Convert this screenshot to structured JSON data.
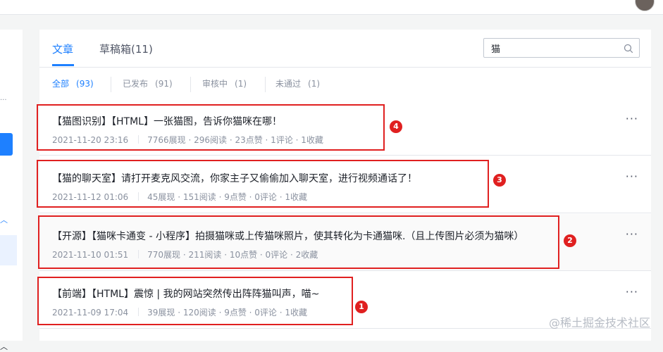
{
  "tabs": [
    {
      "label": "文章",
      "active": true
    },
    {
      "label": "草稿箱(11)",
      "active": false
    }
  ],
  "search": {
    "value": "猫",
    "icon": "search-icon"
  },
  "filters": [
    {
      "label": "全部",
      "count": "(93)",
      "active": true
    },
    {
      "label": "已发布",
      "count": "(91)",
      "active": false
    },
    {
      "label": "审核中",
      "count": "(1)",
      "active": false
    },
    {
      "label": "未通过",
      "count": "(1)",
      "active": false
    }
  ],
  "articles": [
    {
      "title": "【猫图识别】【HTML】一张猫图，告诉你猫咪在哪！",
      "date": "2021-11-20 23:16",
      "stats": "7766展现 · 296阅读 · 23点赞 · 1评论 · 1收藏",
      "badge": "4"
    },
    {
      "title": "【猫的聊天室】请打开麦克风交流，你家主子又偷偷加入聊天室，进行视频通话了！",
      "date": "2021-11-12 01:06",
      "stats": "45展现 · 151阅读 · 9点赞 · 0评论 · 1收藏",
      "badge": "3"
    },
    {
      "title": "【开源】【猫咪卡通变 - 小程序】拍摄猫咪或上传猫咪照片，使其转化为卡通猫咪.（且上传图片必须为猫咪）",
      "date": "2021-11-10 01:51",
      "stats": "770展现 · 211阅读 · 10点赞 · 0评论 · 2收藏",
      "badge": "2"
    },
    {
      "title": "【前端】【HTML】震惊 | 我的网站突然传出阵阵猫叫声，喵~",
      "date": "2021-11-09 17:04",
      "stats": "39展现 · 120阅读 · 9点赞 · 0评论 · 1收藏",
      "badge": "1"
    }
  ],
  "more_label": "···",
  "watermark": "@稀土掘金技术社区",
  "colors": {
    "accent": "#1e80ff",
    "annotation_red": "#e02020"
  }
}
